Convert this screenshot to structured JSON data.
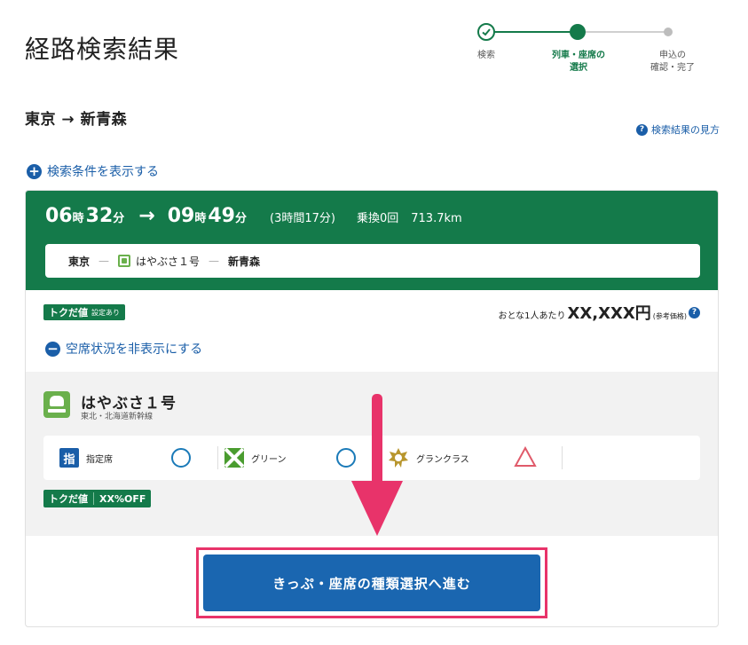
{
  "page": {
    "title": "経路検索結果"
  },
  "stepper": {
    "steps": [
      {
        "label": "検索",
        "state": "done"
      },
      {
        "label": "列車・座席の\n選択",
        "state": "current"
      },
      {
        "label": "申込の\n確認・完了",
        "state": "todo"
      }
    ]
  },
  "route": {
    "text": "東京 → 新青森"
  },
  "help": {
    "label": "検索結果の見方",
    "icon": "?"
  },
  "conditions": {
    "show_label": "検索条件を表示する",
    "icon": "+"
  },
  "result": {
    "depart_hour": "06",
    "depart_min": "32",
    "arrive_hour": "09",
    "arrive_min": "49",
    "hour_unit": "時",
    "min_unit": "分",
    "arrow": "→",
    "duration": "(3時間17分)",
    "transfers": "乗換0回",
    "distance": "713.7km",
    "route_bar": {
      "from": "東京",
      "train": "はやぶさ１号",
      "to": "新青森",
      "dash": "—"
    },
    "toku_badge": {
      "label": "トクだ値",
      "note": "設定あり"
    },
    "price": {
      "prefix": "おとな1人あたり",
      "amount": "XX,XXX円",
      "note": "(参考価格)"
    },
    "hide_seat_label": "空席状況を非表示にする",
    "hide_icon": "−",
    "train": {
      "name": "はやぶさ１号",
      "line": "東北・北海道新幹線"
    },
    "seats": [
      {
        "icon": "shitei-icon",
        "icon_text": "指",
        "label": "指定席",
        "availability": "○"
      },
      {
        "icon": "green-icon",
        "label": "グリーン",
        "availability": "○"
      },
      {
        "icon": "gran-class-icon",
        "label": "グランクラス",
        "availability": "△"
      }
    ],
    "deal": {
      "label": "トクだ値",
      "discount": "XX%OFF"
    },
    "proceed_button": "きっぷ・座席の種類選択へ進む"
  },
  "colors": {
    "brand_green": "#147a4a",
    "link_blue": "#1a5ea8",
    "button_blue": "#1a66b0",
    "highlight_pink": "#e8336a"
  }
}
